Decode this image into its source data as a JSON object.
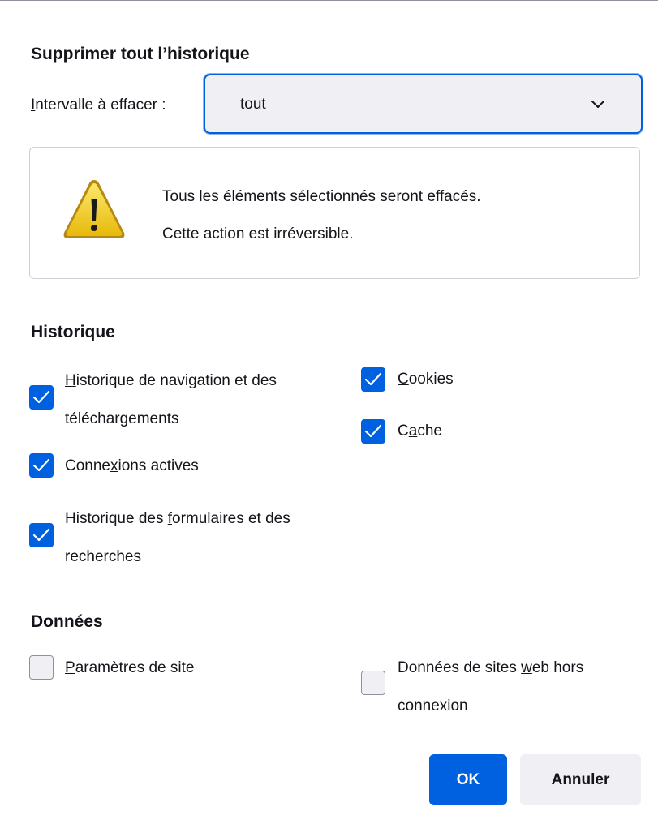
{
  "dialog": {
    "title": "Supprimer tout l’historique"
  },
  "range": {
    "label_accesskey": "I",
    "label_rest": "ntervalle à effacer :",
    "selected": "tout"
  },
  "warning": {
    "line1": "Tous les éléments sélectionnés seront effacés.",
    "line2": "Cette action est irréversible."
  },
  "history": {
    "heading": "Historique",
    "items": [
      {
        "label_accesskey": "H",
        "label_rest_line1": "istorique de navigation et des",
        "label_line2": "téléchargements",
        "checked": true
      },
      {
        "label_pre": "Conne",
        "label_accesskey": "x",
        "label_post": "ions actives",
        "checked": true
      },
      {
        "label_pre_line1": "Historique des ",
        "label_accesskey": "f",
        "label_post_line1": "ormulaires et des",
        "label_line2": "recherches",
        "checked": true
      },
      {
        "label_accesskey": "C",
        "label_rest": "ookies",
        "checked": true
      },
      {
        "label_pre": "C",
        "label_accesskey": "a",
        "label_post": "che",
        "checked": true
      }
    ]
  },
  "data_section": {
    "heading": "Données",
    "items": [
      {
        "label_accesskey": "P",
        "label_rest": "aramètres de site",
        "checked": false
      },
      {
        "label_pre_line1": "Données de sites ",
        "label_accesskey": "w",
        "label_post_line1": "eb hors",
        "label_line2": "connexion",
        "checked": false
      }
    ]
  },
  "buttons": {
    "ok": "OK",
    "cancel": "Annuler"
  },
  "colors": {
    "accent": "#0061e0",
    "checkbox_unchecked_bg": "#f0f0f4",
    "warning_yellow": "#f5d11c"
  },
  "icons": {
    "dropdown": "chevron-down-icon",
    "warning": "warning-triangle-icon",
    "check": "checkmark-icon"
  }
}
